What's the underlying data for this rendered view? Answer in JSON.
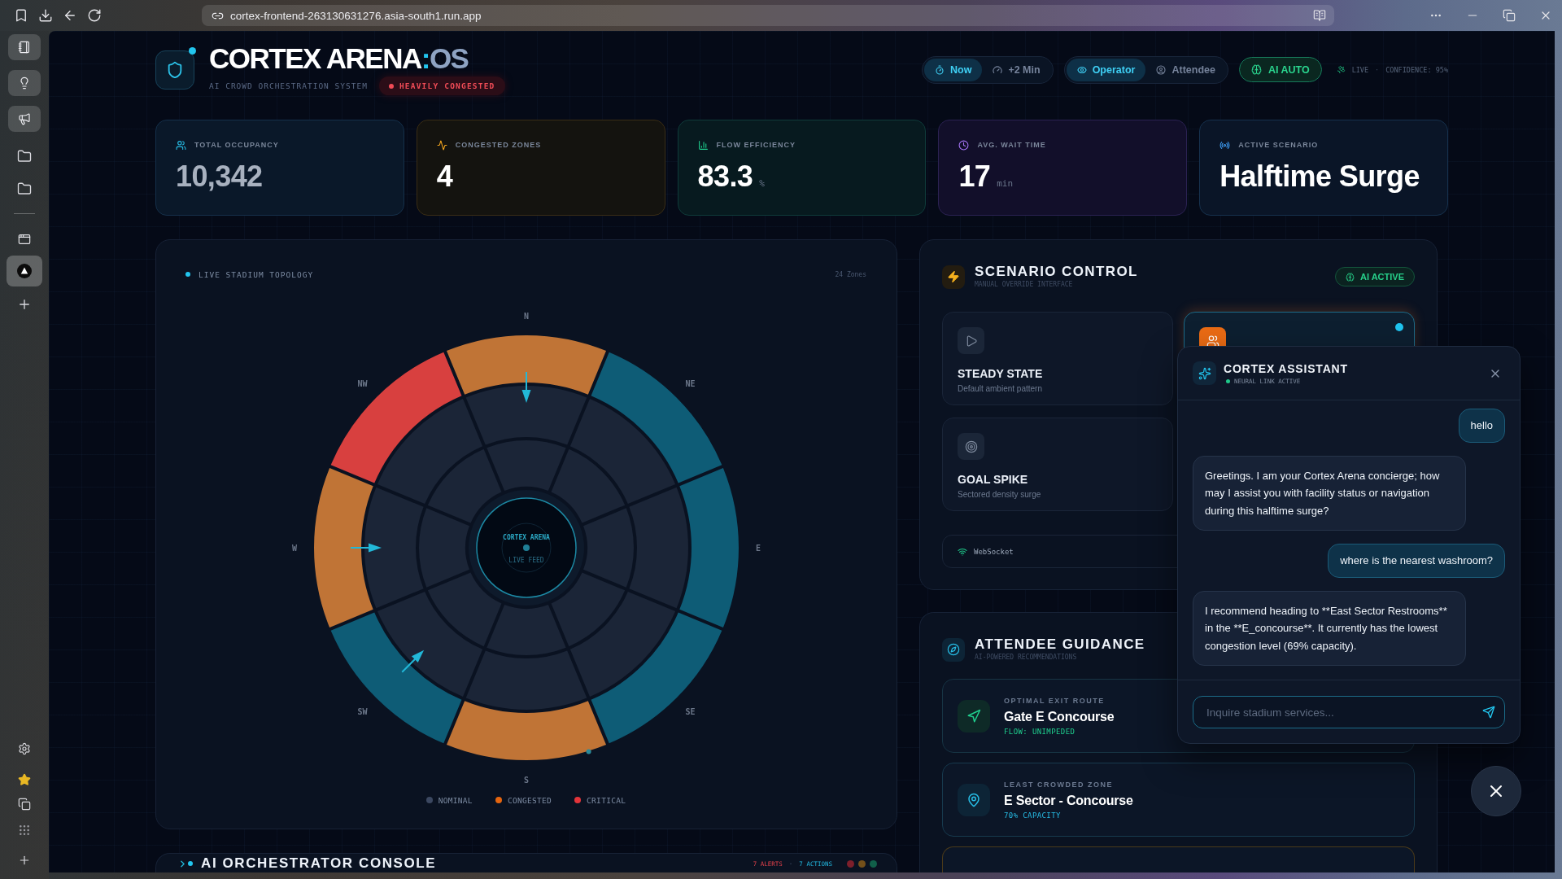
{
  "browser": {
    "url": "cortex-frontend-263130631276.asia-south1.run.app",
    "pinned": [
      {
        "kind": "notebook"
      },
      {
        "kind": "bulb"
      },
      {
        "kind": "megaphone"
      }
    ],
    "bookmarks": [
      {
        "kind": "folder"
      },
      {
        "kind": "folder"
      }
    ],
    "tabs": [
      {
        "kind": "window",
        "selected": false
      },
      {
        "kind": "triangle",
        "selected": true
      }
    ]
  },
  "header": {
    "title": {
      "main": "CORTEX ARENA",
      "separator": ":",
      "suffix": "OS"
    },
    "subtitle": "AI CROWD ORCHESTRATION SYSTEM",
    "status": {
      "label": "HEAVILY CONGESTED",
      "alert": true
    },
    "time_modes": [
      {
        "kind": "now",
        "label": "Now",
        "selected": true
      },
      {
        "kind": "forecast",
        "label": "+2 Min",
        "selected": false
      }
    ],
    "views": [
      {
        "kind": "operator",
        "label": "Operator",
        "selected": true
      },
      {
        "kind": "attendee",
        "label": "Attendee",
        "selected": false
      }
    ],
    "ai_mode": {
      "label": "AI AUTO",
      "on": true
    },
    "live": {
      "label": "LIVE",
      "separator": "·",
      "confidence": "CONFIDENCE: 95%"
    }
  },
  "kpis": [
    {
      "kind": "occupancy",
      "label": "TOTAL OCCUPANCY",
      "value": "10,342"
    },
    {
      "kind": "congestion",
      "label": "CONGESTED ZONES",
      "value": "4"
    },
    {
      "kind": "flow",
      "label": "FLOW EFFICIENCY",
      "value": "83.3",
      "unit": "%"
    },
    {
      "kind": "wait",
      "label": "AVG. WAIT TIME",
      "value": "17",
      "unit": "min"
    },
    {
      "kind": "scenario",
      "label": "ACTIVE SCENARIO",
      "value": "Halftime Surge"
    }
  ],
  "topology": {
    "title": "LIVE STADIUM TOPOLOGY",
    "zone_count": "24 Zones",
    "hub_title": "CORTEX ARENA",
    "hub_subtitle": "LIVE FEED",
    "sectors": [
      {
        "label": "N",
        "inflow": true,
        "rings": [
          {
            "color": "#c07436"
          },
          {
            "color": "#1b2537"
          },
          {
            "color": "#1b2537"
          }
        ]
      },
      {
        "label": "NE",
        "inflow": false,
        "rings": [
          {
            "color": "#0e5c76"
          },
          {
            "color": "#1b2537"
          },
          {
            "color": "#1b2537"
          }
        ]
      },
      {
        "label": "E",
        "inflow": false,
        "rings": [
          {
            "color": "#0e5c76"
          },
          {
            "color": "#1b2537"
          },
          {
            "color": "#1b2537"
          }
        ]
      },
      {
        "label": "SE",
        "inflow": false,
        "rings": [
          {
            "color": "#0e5c76"
          },
          {
            "color": "#1b2537"
          },
          {
            "color": "#1b2537"
          }
        ]
      },
      {
        "label": "S",
        "inflow": false,
        "rings": [
          {
            "color": "#c07436"
          },
          {
            "color": "#1b2537"
          },
          {
            "color": "#1b2537"
          }
        ]
      },
      {
        "label": "SW",
        "inflow": true,
        "rings": [
          {
            "color": "#0e5c76"
          },
          {
            "color": "#1b2537"
          },
          {
            "color": "#1b2537"
          }
        ]
      },
      {
        "label": "W",
        "inflow": true,
        "rings": [
          {
            "color": "#c07436"
          },
          {
            "color": "#1b2537"
          },
          {
            "color": "#1b2537"
          }
        ]
      },
      {
        "label": "NW",
        "inflow": false,
        "rings": [
          {
            "color": "#d8403f"
          },
          {
            "color": "#1b2537"
          },
          {
            "color": "#1b2537"
          }
        ]
      }
    ],
    "legend": [
      {
        "label": "NOMINAL",
        "color": "#3b4760"
      },
      {
        "label": "CONGESTED",
        "color": "#e5650f"
      },
      {
        "label": "CRITICAL",
        "color": "#e3343a"
      }
    ]
  },
  "console": {
    "title": "AI ORCHESTRATOR CONSOLE",
    "alerts": "7 ALERTS",
    "separator": "·",
    "actions": "7 ACTIONS",
    "lights": [
      {
        "color": "#7d1f2b"
      },
      {
        "color": "#74501a"
      },
      {
        "color": "#11604a"
      }
    ]
  },
  "scenario_control": {
    "title": "SCENARIO CONTROL",
    "subtitle": "MANUAL OVERRIDE INTERFACE",
    "ai_badge": {
      "label": "AI ACTIVE",
      "on": true
    },
    "scenarios": [
      {
        "kind": "steady",
        "name": "STEADY STATE",
        "description": "Default ambient pattern",
        "selected": false
      },
      {
        "kind": "halftime",
        "selected": true
      },
      {
        "kind": "goal",
        "name": "GOAL SPIKE",
        "description": "Sectored density surge",
        "selected": false
      }
    ],
    "connection": {
      "label": "WebSocket"
    }
  },
  "guidance": {
    "title": "ATTENDEE GUIDANCE",
    "subtitle": "AI-POWERED RECOMMENDATIONS",
    "cards": [
      {
        "kind": "route",
        "label": "OPTIMAL EXIT ROUTE",
        "value": "Gate E Concourse",
        "note": "FLOW: UNIMPEDED"
      },
      {
        "kind": "zone",
        "label": "LEAST CROWDED ZONE",
        "value": "E Sector - Concourse",
        "note": "70% CAPACITY"
      },
      {
        "kind": "alert"
      }
    ]
  },
  "assistant": {
    "open": true,
    "title": "CORTEX ASSISTANT",
    "status": "NEURAL LINK ACTIVE",
    "online": true,
    "messages": [
      {
        "kind": "user",
        "text": "hello"
      },
      {
        "kind": "assistant",
        "text": "Greetings. I am your Cortex Arena concierge; how may I assist you with facility status or navigation during this halftime surge?"
      },
      {
        "kind": "user",
        "text": "where is the nearest washroom?"
      },
      {
        "kind": "assistant",
        "text": "I recommend heading to **East Sector Restrooms** in the **E_concourse**. It currently has the lowest congestion level (69% capacity)."
      }
    ],
    "input": {
      "placeholder": "Inquire stadium services..."
    }
  }
}
